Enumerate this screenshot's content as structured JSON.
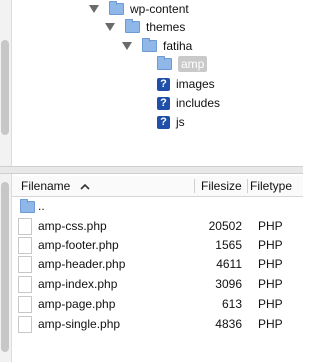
{
  "tree": {
    "items": [
      {
        "label": "wp-content"
      },
      {
        "label": "themes"
      },
      {
        "label": "fatiha"
      },
      {
        "label": "amp"
      },
      {
        "label": "images"
      },
      {
        "label": "includes"
      },
      {
        "label": "js"
      }
    ],
    "unknown_glyph": "?"
  },
  "list": {
    "columns": {
      "filename": "Filename",
      "filesize": "Filesize",
      "filetype": "Filetype"
    },
    "sort_indicator": "^",
    "parent_row": "..",
    "rows": [
      {
        "name": "amp-css.php",
        "size": "20502",
        "type": "PHP"
      },
      {
        "name": "amp-footer.php",
        "size": "1565",
        "type": "PHP"
      },
      {
        "name": "amp-header.php",
        "size": "4611",
        "type": "PHP"
      },
      {
        "name": "amp-index.php",
        "size": "3096",
        "type": "PHP"
      },
      {
        "name": "amp-page.php",
        "size": "613",
        "type": "PHP"
      },
      {
        "name": "amp-single.php",
        "size": "4836",
        "type": "PHP"
      }
    ]
  }
}
